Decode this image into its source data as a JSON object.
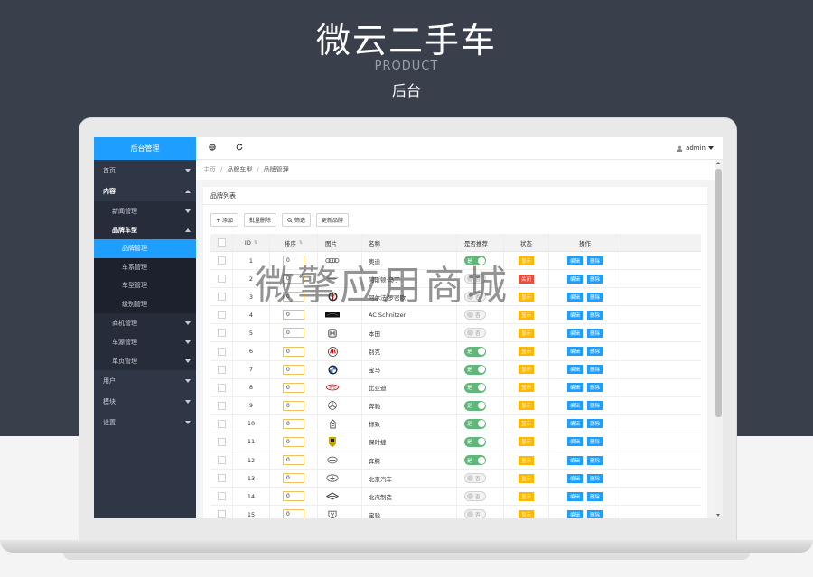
{
  "hero": {
    "title": "微云二手车",
    "subtitle": "PRODUCT",
    "subtitle2": "后台"
  },
  "sidebar": {
    "header": "后台管理",
    "items": [
      {
        "label": "首页"
      },
      {
        "label": "内容"
      },
      {
        "label": "新闻管理"
      },
      {
        "label": "品牌车型"
      },
      {
        "label": "品牌管理"
      },
      {
        "label": "车系管理"
      },
      {
        "label": "车型管理"
      },
      {
        "label": "级别管理"
      },
      {
        "label": "商机管理"
      },
      {
        "label": "车源管理"
      },
      {
        "label": "单页管理"
      },
      {
        "label": "用户"
      },
      {
        "label": "模块"
      },
      {
        "label": "设置"
      }
    ]
  },
  "topbar": {
    "user": "admin",
    "globe_icon": "globe-icon",
    "refresh_icon": "refresh-icon"
  },
  "breadcrumb": {
    "home": "主页",
    "parent": "品牌车型",
    "current": "品牌管理",
    "sep": "/"
  },
  "panel": {
    "title": "品牌列表"
  },
  "toolbar": {
    "add": "+ 添加",
    "batch_delete": "批量删除",
    "filter": "筛选",
    "update": "更新品牌"
  },
  "table": {
    "headers": {
      "id": "ID",
      "sort": "排序",
      "image": "图片",
      "name": "名称",
      "recommend": "是否推荐",
      "status": "状态",
      "ops": "操作"
    },
    "sort_arrows": "⇅",
    "on_label": "是",
    "off_label": "否",
    "show_label": "显示",
    "hide_label": "关闭",
    "edit_label": "编辑",
    "delete_label": "删除",
    "rows": [
      {
        "id": "1",
        "sort": "0",
        "name": "奥迪",
        "recommend": true,
        "status": "show"
      },
      {
        "id": "2",
        "sort": "0",
        "name": "阿斯顿·马丁",
        "recommend": false,
        "status": "off"
      },
      {
        "id": "3",
        "sort": "0",
        "name": "阿尔法·罗密欧",
        "recommend": false,
        "status": "show"
      },
      {
        "id": "4",
        "sort": "0",
        "name": "AC Schnitzer",
        "recommend": false,
        "status": "show"
      },
      {
        "id": "5",
        "sort": "0",
        "name": "本田",
        "recommend": false,
        "status": "show"
      },
      {
        "id": "6",
        "sort": "0",
        "name": "别克",
        "recommend": true,
        "status": "show"
      },
      {
        "id": "7",
        "sort": "0",
        "name": "宝马",
        "recommend": true,
        "status": "show"
      },
      {
        "id": "8",
        "sort": "0",
        "name": "比亚迪",
        "recommend": true,
        "status": "show"
      },
      {
        "id": "9",
        "sort": "0",
        "name": "奔驰",
        "recommend": true,
        "status": "show"
      },
      {
        "id": "10",
        "sort": "0",
        "name": "标致",
        "recommend": true,
        "status": "show"
      },
      {
        "id": "11",
        "sort": "0",
        "name": "保时捷",
        "recommend": true,
        "status": "show"
      },
      {
        "id": "12",
        "sort": "0",
        "name": "奔腾",
        "recommend": true,
        "status": "show"
      },
      {
        "id": "13",
        "sort": "0",
        "name": "北京汽车",
        "recommend": false,
        "status": "show"
      },
      {
        "id": "14",
        "sort": "0",
        "name": "北汽制造",
        "recommend": false,
        "status": "show"
      },
      {
        "id": "15",
        "sort": "0",
        "name": "宝骏",
        "recommend": false,
        "status": "show"
      }
    ]
  },
  "watermark": "微擎应用商城"
}
